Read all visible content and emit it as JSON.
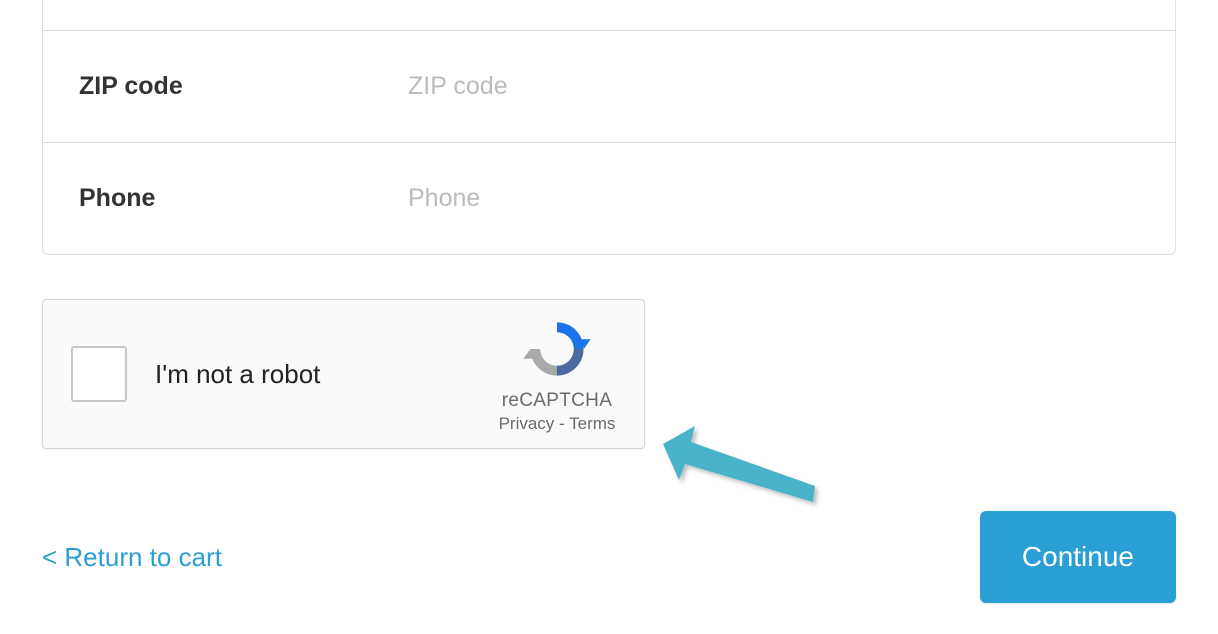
{
  "form": {
    "zip": {
      "label": "ZIP code",
      "placeholder": "ZIP code",
      "value": ""
    },
    "phone": {
      "label": "Phone",
      "placeholder": "Phone",
      "value": ""
    }
  },
  "captcha": {
    "label": "I'm not a robot",
    "brand": "reCAPTCHA",
    "privacy": "Privacy",
    "separator": " - ",
    "terms": "Terms"
  },
  "footer": {
    "return_label": "< Return to cart",
    "continue_label": "Continue"
  }
}
